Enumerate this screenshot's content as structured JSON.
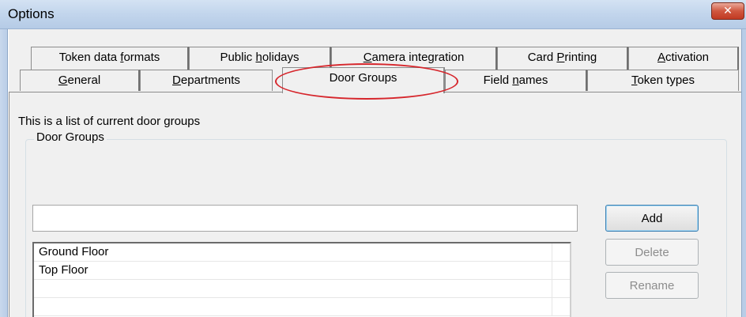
{
  "window": {
    "title": "Options",
    "close_glyph": "✕"
  },
  "tabs": {
    "back_row": [
      {
        "pre": "Token data ",
        "key": "f",
        "post": "ormats"
      },
      {
        "pre": "Public ",
        "key": "h",
        "post": "olidays"
      },
      {
        "pre": "",
        "key": "C",
        "post": "amera integration"
      },
      {
        "pre": "Card ",
        "key": "P",
        "post": "rinting"
      },
      {
        "pre": "",
        "key": "A",
        "post": "ctivation"
      }
    ],
    "front_row": [
      {
        "pre": "",
        "key": "G",
        "post": "eneral"
      },
      {
        "pre": "",
        "key": "D",
        "post": "epartments"
      },
      {
        "pre": "Door Groups",
        "key": "",
        "post": ""
      },
      {
        "pre": "Field ",
        "key": "n",
        "post": "ames"
      },
      {
        "pre": "",
        "key": "T",
        "post": "oken types"
      }
    ],
    "selected": "Door Groups"
  },
  "panel": {
    "description": "This is a list of current door groups",
    "groupbox_label": "Door Groups",
    "input_value": "",
    "list_items": [
      "Ground Floor",
      "Top Floor",
      "",
      ""
    ],
    "buttons": {
      "add": "Add",
      "delete": "Delete",
      "rename": "Rename"
    }
  },
  "colors": {
    "annotation": "#d6262c",
    "titlebar": "#c2d5ec",
    "close_button": "#c13a22"
  }
}
